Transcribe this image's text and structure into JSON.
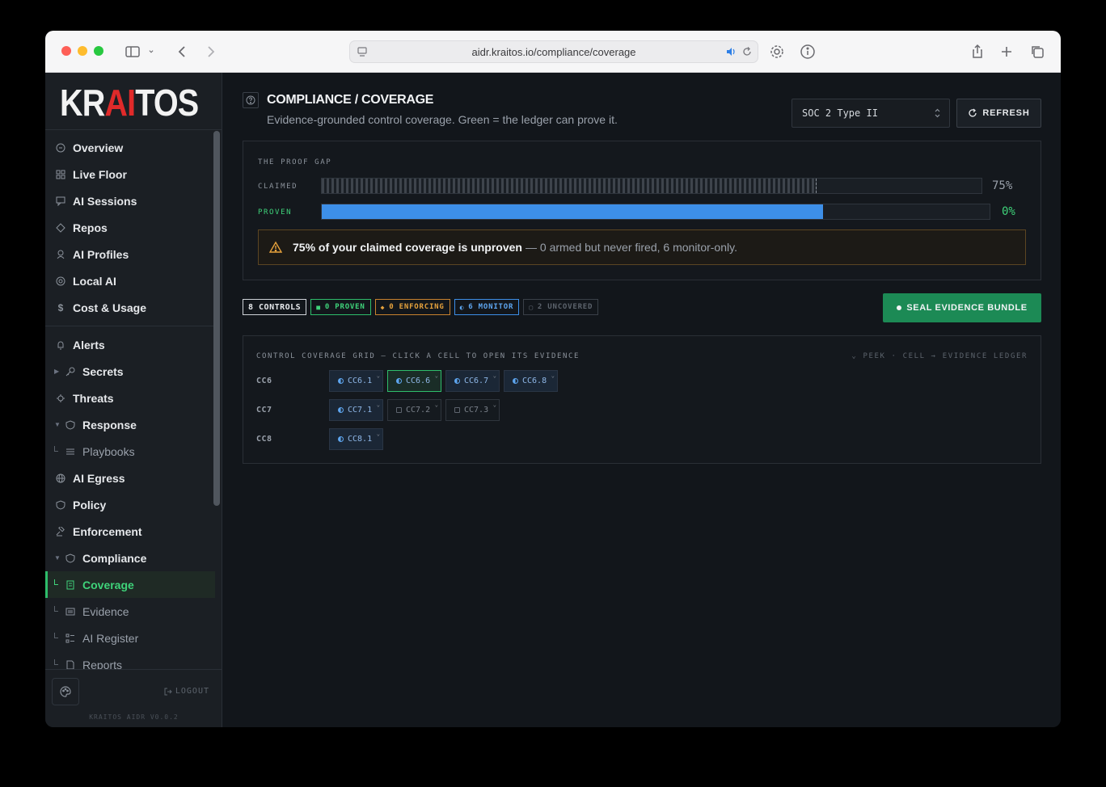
{
  "browser": {
    "url": "aidr.kraitos.io/compliance/coverage"
  },
  "sidebar": {
    "logo": {
      "pre": "KR",
      "ai": "AI",
      "post": "TOS"
    },
    "items": [
      {
        "label": "Overview",
        "icon": "dashboard-icon"
      },
      {
        "label": "Live Floor",
        "icon": "grid-icon"
      },
      {
        "label": "AI Sessions",
        "icon": "chat-icon"
      },
      {
        "label": "Repos",
        "icon": "repo-icon"
      },
      {
        "label": "AI Profiles",
        "icon": "profile-icon"
      },
      {
        "label": "Local AI",
        "icon": "chip-icon"
      },
      {
        "label": "Cost & Usage",
        "icon": "dollar-icon"
      },
      {
        "label": "Alerts",
        "icon": "bell-icon"
      },
      {
        "label": "Secrets",
        "icon": "key-icon"
      },
      {
        "label": "Threats",
        "icon": "bug-icon"
      },
      {
        "label": "Response",
        "icon": "shield-icon"
      },
      {
        "label": "Playbooks",
        "icon": "playbook-icon"
      },
      {
        "label": "AI Egress",
        "icon": "globe-icon"
      },
      {
        "label": "Policy",
        "icon": "shield-icon"
      },
      {
        "label": "Enforcement",
        "icon": "gavel-icon"
      },
      {
        "label": "Compliance",
        "icon": "shield-icon"
      },
      {
        "label": "Coverage",
        "icon": "document-icon"
      },
      {
        "label": "Evidence",
        "icon": "archive-icon"
      },
      {
        "label": "AI Register",
        "icon": "list-icon"
      },
      {
        "label": "Reports",
        "icon": "file-icon"
      }
    ],
    "logout": "LOGOUT",
    "version": "KRAITOS AIDR V0.0.2"
  },
  "header": {
    "title": "COMPLIANCE / COVERAGE",
    "subtitle": "Evidence-grounded control coverage. Green = the ledger can prove it.",
    "framework": "SOC 2 Type II",
    "refresh_label": "REFRESH"
  },
  "proof_gap": {
    "title": "THE PROOF GAP",
    "claimed_label": "CLAIMED",
    "claimed_pct": "75%",
    "claimed_fraction": 0.75,
    "proven_label": "PROVEN",
    "proven_pct": "0%",
    "proven_fraction": 0.75,
    "warning_bold": "75% of your claimed coverage is unproven",
    "warning_rest": "— 0 armed but never fired, 6 monitor-only."
  },
  "summary": {
    "total": "8 CONTROLS",
    "proven": "0 PROVEN",
    "enforcing": "0 ENFORCING",
    "monitor": "6 MONITOR",
    "uncovered": "2 UNCOVERED"
  },
  "seal_label": "SEAL EVIDENCE BUNDLE",
  "grid": {
    "title": "CONTROL COVERAGE GRID — CLICK A CELL TO OPEN ITS EVIDENCE",
    "hint": "⌄ PEEK · CELL → EVIDENCE LEDGER",
    "rows": [
      {
        "label": "CC6",
        "cells": [
          {
            "id": "CC6.1",
            "status": "monitor"
          },
          {
            "id": "CC6.6",
            "status": "monitor"
          },
          {
            "id": "CC6.7",
            "status": "monitor"
          },
          {
            "id": "CC6.8",
            "status": "monitor"
          }
        ]
      },
      {
        "label": "CC7",
        "cells": [
          {
            "id": "CC7.1",
            "status": "monitor"
          },
          {
            "id": "CC7.2",
            "status": "uncovered"
          },
          {
            "id": "CC7.3",
            "status": "uncovered"
          }
        ]
      },
      {
        "label": "CC8",
        "cells": [
          {
            "id": "CC8.1",
            "status": "monitor"
          }
        ]
      }
    ]
  }
}
